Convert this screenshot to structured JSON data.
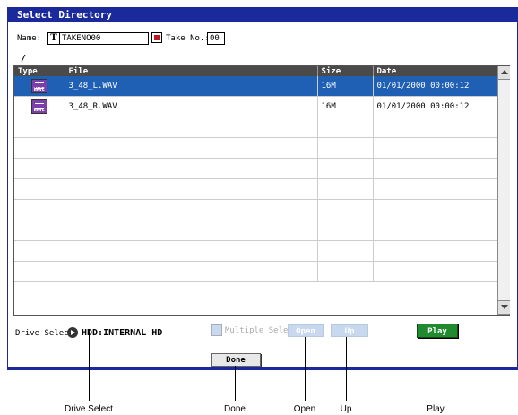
{
  "dialog": {
    "title": "Select Directory"
  },
  "name_row": {
    "name_label": "Name:",
    "t_button": "T",
    "name_value": "TAKENO00",
    "take_label": "Take No.:",
    "take_value": "00"
  },
  "path": "/",
  "table": {
    "headers": [
      "Type",
      "File",
      "Size",
      "Date"
    ],
    "rows": [
      {
        "type_icon": "wave-file-icon",
        "file": "3_48_L.WAV",
        "size": "16M",
        "date": "01/01/2000 00:00:12",
        "selected": true
      },
      {
        "type_icon": "wave-file-icon",
        "file": "3_48_R.WAV",
        "size": "16M",
        "date": "01/01/2000 00:00:12",
        "selected": false
      }
    ],
    "empty_rows": 8
  },
  "drive": {
    "label": "Drive Select:",
    "value": "HDD:INTERNAL HD"
  },
  "controls": {
    "multiple_select": "Multiple Select",
    "open": "Open",
    "up": "Up",
    "play": "Play",
    "done": "Done"
  },
  "callouts": [
    "Drive Select",
    "Done",
    "Open",
    "Up",
    "Play"
  ],
  "colors": {
    "title_bar": "#1a2a9a",
    "selected_row": "#1f5fb4",
    "play_button": "#1f8a2e",
    "disabled_button": "#c8d8ee"
  }
}
